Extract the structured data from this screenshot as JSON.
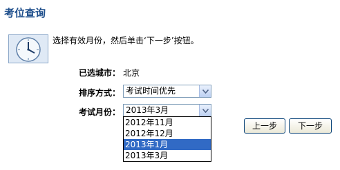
{
  "page": {
    "title": "考位查询"
  },
  "instruction": {
    "text": "选择有效月份，然后单击‘下一步’按钮。",
    "icon": "clock-icon"
  },
  "form": {
    "city": {
      "label": "已选城市：",
      "value": "北京"
    },
    "sort": {
      "label": "排序方式：",
      "selected": "考试时间优先"
    },
    "month": {
      "label": "考试月份：",
      "selected": "2013年3月",
      "options": [
        "2012年11月",
        "2012年12月",
        "2013年1月",
        "2013年3月"
      ],
      "highlighted": "2013年1月"
    }
  },
  "buttons": {
    "prev": "上一步",
    "next": "下一步"
  },
  "colors": {
    "title": "#1f4f8c",
    "highlight": "#316ac5",
    "border": "#7f9db9"
  }
}
